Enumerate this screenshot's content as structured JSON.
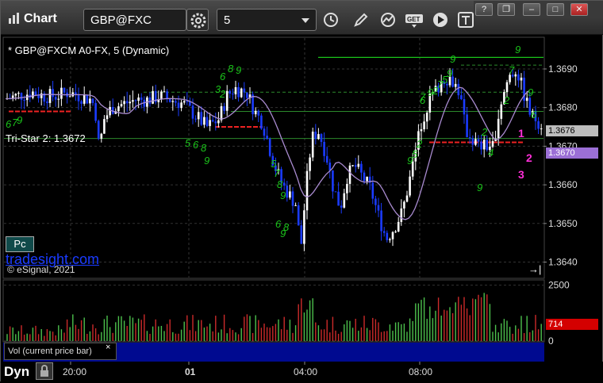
{
  "window": {
    "title": "Chart",
    "controls": {
      "help": "?",
      "restore": "❐",
      "minimize": "–",
      "maximize": "□",
      "close": "✕"
    }
  },
  "toolbar": {
    "symbol": "GBP@FXC",
    "interval": "5",
    "icons": [
      "settings-gear-icon",
      "clock-icon",
      "pencil-icon",
      "indicator-chart-icon",
      "get-icon",
      "play-icon",
      "text-tool-icon"
    ]
  },
  "chart": {
    "symbol_label": "* GBP@FXCM A0-FX, 5 (Dynamic)",
    "tristar_label": "Tri-Star 2: 1.3672",
    "pc_badge": "Pc",
    "watermark": "tradesight.com",
    "copyright": "© eSignal, 2021",
    "scroll_arrow": "→|",
    "colors": {
      "up_candle": "#ffffff",
      "down_candle": "#1a3bff",
      "ma_line": "#a98bd0",
      "vol_up": "#4cc04c",
      "vol_down": "#cc2a2a",
      "signal": "#1bc41b",
      "current_price": "#c8c8c8",
      "tristar_price": "#9b6fd6",
      "vol_value_bg": "#d40000"
    }
  },
  "price_scale": {
    "current": "1.3676",
    "tristar": "1.3670"
  },
  "volume": {
    "label": "Vol (current price bar)",
    "close": "×",
    "current": "714"
  },
  "bottom": {
    "dyn_label": "Dyn"
  },
  "chart_data": {
    "type": "candlestick",
    "title": "* GBP@FXCM A0-FX, 5 (Dynamic)",
    "y_ticks": [
      "1.3690",
      "1.3680",
      "1.3670",
      "1.3660",
      "1.3650",
      "1.3640"
    ],
    "ylim": [
      1.3636,
      1.3698
    ],
    "x_ticks": [
      "20:00",
      "01",
      "04:00",
      "08:00"
    ],
    "volume_ticks": [
      "2500",
      "0"
    ],
    "volume_ylim": [
      0,
      2700
    ],
    "series": [
      {
        "name": "Vol (current price bar)",
        "current_value": 714
      }
    ],
    "annotations": [
      {
        "text": "Tri-Star 2: 1.3672",
        "price": 1.3672
      },
      {
        "text": "1",
        "color": "#ff2fd8"
      },
      {
        "text": "2",
        "color": "#ff2fd8"
      },
      {
        "text": "3",
        "color": "#ff2fd8"
      }
    ],
    "reference_levels": [
      1.3693,
      1.3684,
      1.3679,
      1.3675,
      1.3672,
      1.3671
    ],
    "grid": true
  }
}
